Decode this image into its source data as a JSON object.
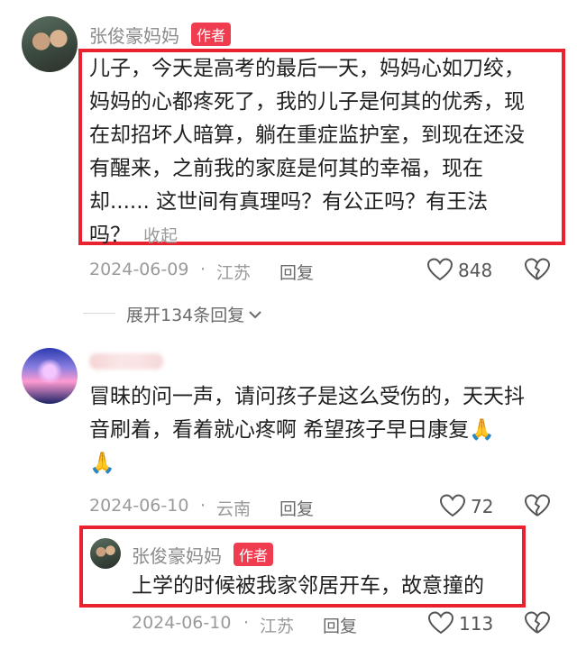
{
  "comments": [
    {
      "author": "张俊豪妈妈",
      "badge": "作者",
      "lines": [
        "儿子，今天是高考的最后一天，妈妈心如刀绞，",
        "妈妈的心都疼死了，我的儿子是何其的优秀，现",
        "在却招坏人暗算，躺在重症监护室，到现在还没",
        "有醒来，之前我的家庭是何其的幸福，现在",
        "却...... 这世间有真理吗？有公正吗？有王法",
        "吗？"
      ],
      "collapse_label": "收起",
      "date": "2024-06-09",
      "location": "江苏",
      "reply_label": "回复",
      "likes": "848",
      "expand_label": "展开134条回复"
    },
    {
      "author": "",
      "lines": [
        "冒昧的问一声，请问孩子是这么受伤的，天天抖",
        "音刷着，看着就心疼啊  希望孩子早日康复🙏",
        "🙏"
      ],
      "date": "2024-06-10",
      "location": "云南",
      "reply_label": "回复",
      "likes": "72",
      "reply": {
        "author": "张俊豪妈妈",
        "badge": "作者",
        "text": "上学的时候被我家邻居开车，故意撞的",
        "date": "2024-06-10",
        "location": "江苏",
        "reply_label": "回复",
        "likes": "113"
      }
    }
  ],
  "separator": "·",
  "icons": [
    "heart-icon",
    "broken-heart-icon",
    "chevron-down-icon"
  ],
  "colors": {
    "highlight_box": "#e8232f",
    "author_badge": "#f03c4f"
  }
}
